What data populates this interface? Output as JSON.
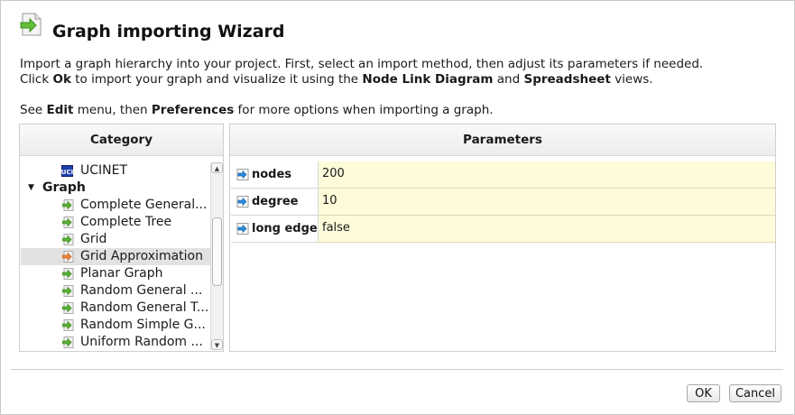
{
  "window": {
    "title": "Graph importing Wizard"
  },
  "description": {
    "line1": "Import a graph hierarchy into your project. First, select an import method, then adjust its parameters if needed.",
    "line2_a": "Click ",
    "line2_ok": "Ok",
    "line2_b": " to import your graph and visualize it using the ",
    "line2_nld": "Node Link Diagram",
    "line2_c": " and ",
    "line2_ss": "Spreadsheet",
    "line2_d": " views.",
    "line3_a": "See ",
    "line3_edit": "Edit",
    "line3_b": " menu, then ",
    "line3_prefs": "Preferences",
    "line3_c": " for more options when importing a graph."
  },
  "category": {
    "header": "Category",
    "items": [
      {
        "label": "UCINET",
        "kind": "plugin",
        "icon": "ucinet-icon"
      },
      {
        "label": "Graph",
        "kind": "group",
        "expanded": true,
        "icon": "triangle-down-icon"
      },
      {
        "label": "Complete General...",
        "kind": "leaf",
        "icon": "green-arrow-icon"
      },
      {
        "label": "Complete Tree",
        "kind": "leaf",
        "icon": "green-arrow-icon"
      },
      {
        "label": "Grid",
        "kind": "leaf",
        "icon": "green-arrow-icon"
      },
      {
        "label": "Grid Approximation",
        "kind": "leaf",
        "icon": "orange-arrow-icon",
        "selected": true
      },
      {
        "label": "Planar Graph",
        "kind": "leaf",
        "icon": "green-arrow-icon"
      },
      {
        "label": "Random General ...",
        "kind": "leaf",
        "icon": "green-arrow-icon"
      },
      {
        "label": "Random General T...",
        "kind": "leaf",
        "icon": "green-arrow-icon"
      },
      {
        "label": "Random Simple G...",
        "kind": "leaf",
        "icon": "green-arrow-icon"
      },
      {
        "label": "Uniform Random ...",
        "kind": "leaf",
        "icon": "green-arrow-icon"
      }
    ],
    "scroll_position": 0.45
  },
  "parameters": {
    "header": "Parameters",
    "rows": [
      {
        "name": "nodes",
        "value": "200",
        "icon": "blue-arrow-icon"
      },
      {
        "name": "degree",
        "value": "10",
        "icon": "blue-arrow-icon"
      },
      {
        "name": "long edge",
        "value": "false",
        "icon": "blue-arrow-icon"
      }
    ]
  },
  "buttons": {
    "ok": "OK",
    "cancel": "Cancel"
  },
  "colors": {
    "value_cell_bg": "#fdfbd9",
    "selection_bg": "#e2e2e2",
    "import_arrow": "#5ab435"
  }
}
